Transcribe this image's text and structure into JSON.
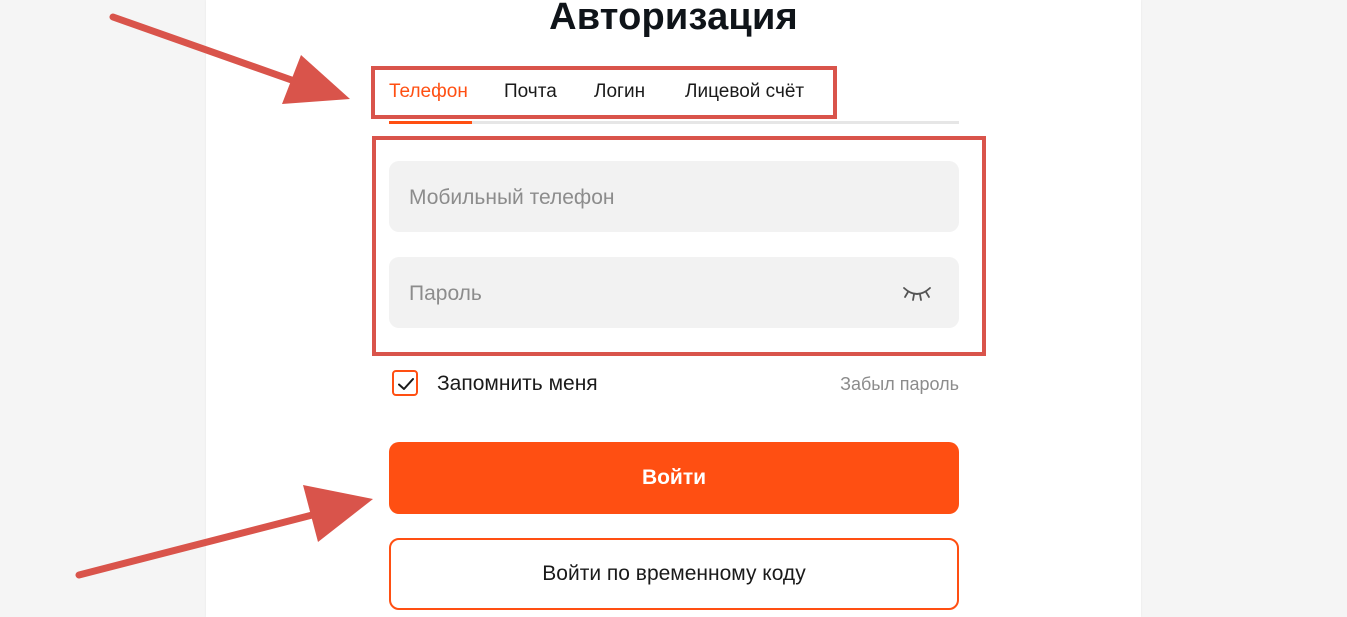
{
  "page": {
    "title": "Авторизация"
  },
  "tabs": [
    {
      "label": "Телефон",
      "active": true
    },
    {
      "label": "Почта",
      "active": false
    },
    {
      "label": "Логин",
      "active": false
    },
    {
      "label": "Лицевой счёт",
      "active": false
    }
  ],
  "form": {
    "phone_placeholder": "Мобильный телефон",
    "phone_value": "",
    "password_placeholder": "Пароль",
    "password_value": "",
    "password_toggle_icon": "eye-closed-icon",
    "remember_label": "Запомнить меня",
    "remember_checked": true,
    "forgot_label": "Забыл пароль",
    "login_button": "Войти",
    "temp_code_button": "Войти по временному коду"
  },
  "colors": {
    "accent": "#ff4f12",
    "annotation": "#d9544b",
    "field_bg": "#f2f2f2",
    "page_bg": "#f5f5f5"
  },
  "annotations": {
    "arrows": [
      "arrow-to-tabs",
      "arrow-to-login-button"
    ],
    "highlight_boxes": [
      "tabs-highlight",
      "fields-highlight"
    ]
  }
}
